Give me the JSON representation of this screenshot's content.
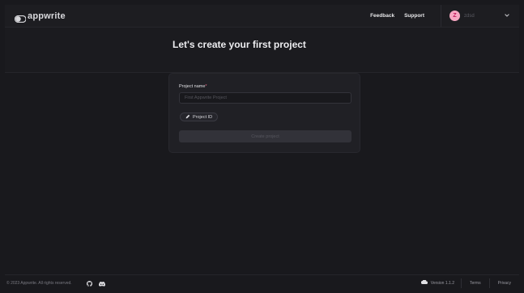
{
  "header": {
    "logo_text": "appwrite",
    "feedback_label": "Feedback",
    "support_label": "Support",
    "user": {
      "avatar_initial": "Z",
      "name": "zdsd"
    }
  },
  "page": {
    "title": "Let's create your first project"
  },
  "form": {
    "project_name_label": "Project name",
    "required_mark": "*",
    "project_name_placeholder": "First Appwrite Project",
    "project_name_value": "",
    "project_id_label": "Project ID",
    "create_label": "Create project"
  },
  "footer": {
    "copyright": "© 2023 Appwrite. All rights reserved.",
    "version": "Version 1.1.2",
    "terms": "Terms",
    "privacy": "Privacy"
  },
  "colors": {
    "background": "#19191d",
    "card": "#202025",
    "avatar": "#f7a7c2",
    "required": "#f06a8a"
  },
  "icons": [
    "appwrite-logo-icon",
    "chevron-down-icon",
    "pencil-icon",
    "github-icon",
    "discord-icon",
    "cloud-icon"
  ]
}
